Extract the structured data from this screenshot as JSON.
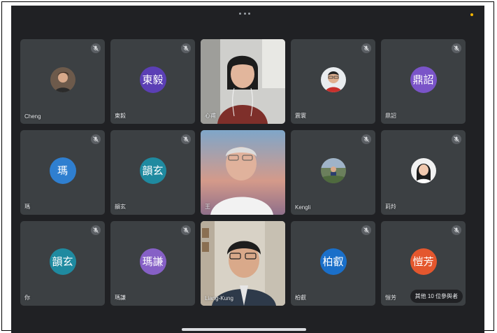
{
  "colors": {
    "background": "#202124",
    "tile": "#3c4043",
    "avatar_dongyi": "#5b3fb5",
    "avatar_dingzhao": "#7a54c8",
    "avatar_ma": "#2f7fd0",
    "avatar_yunxuan": "#1f8aa0",
    "avatar_maqian": "#8660c6",
    "avatar_boxu": "#1a6fc9",
    "avatar_kaifang": "#e4572e"
  },
  "status_icon": "more-dots-icon",
  "tiles": [
    {
      "name": "Cheng",
      "avatar_text": "",
      "kind": "photo"
    },
    {
      "name": "東毅",
      "avatar_text": "東毅",
      "kind": "initials"
    },
    {
      "name": "心甫",
      "avatar_text": "",
      "kind": "video"
    },
    {
      "name": "震寰",
      "avatar_text": "",
      "kind": "photo"
    },
    {
      "name": "鼎詔",
      "avatar_text": "鼎詔",
      "kind": "initials"
    },
    {
      "name": "瑪",
      "avatar_text": "瑪",
      "kind": "initials"
    },
    {
      "name": "韻玄",
      "avatar_text": "韻玄",
      "kind": "initials"
    },
    {
      "name": "王",
      "avatar_text": "",
      "kind": "video"
    },
    {
      "name": "Kengli",
      "avatar_text": "",
      "kind": "photo"
    },
    {
      "name": "莉羚",
      "avatar_text": "",
      "kind": "photo"
    },
    {
      "name": "你",
      "avatar_text": "韻玄",
      "kind": "initials"
    },
    {
      "name": "瑪謙",
      "avatar_text": "瑪謙",
      "kind": "initials"
    },
    {
      "name": "Liang-Kung",
      "avatar_text": "",
      "kind": "video"
    },
    {
      "name": "柏叡",
      "avatar_text": "柏叡",
      "kind": "initials"
    },
    {
      "name": "愷芳",
      "avatar_text": "愷芳",
      "kind": "initials"
    }
  ],
  "others_label": "其他 10 位參與者"
}
